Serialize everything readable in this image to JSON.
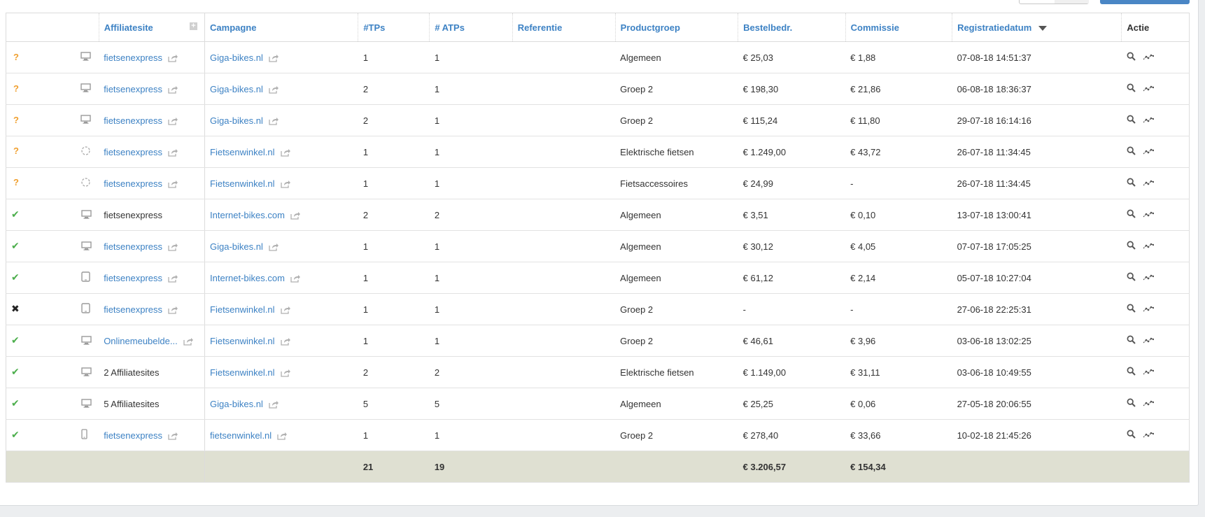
{
  "columns": {
    "affiliatesite": "Affiliatesite",
    "campagne": "Campagne",
    "tps": "#TPs",
    "atps": "# ATPs",
    "referentie": "Referentie",
    "productgroep": "Productgroep",
    "bestelbedr": "Bestelbedr.",
    "commissie": "Commissie",
    "registratiedatum": "Registratiedatum",
    "actie": "Actie"
  },
  "rows": [
    {
      "status": "pending",
      "device": "desktop",
      "site": "fietsenexpress",
      "site_link": true,
      "campaign": "Giga-bikes.nl",
      "tps": "1",
      "atps": "1",
      "ref": "",
      "group": "Algemeen",
      "amount": "€ 25,03",
      "commission": "€ 1,88",
      "date": "07-08-18 14:51:37"
    },
    {
      "status": "pending",
      "device": "desktop",
      "site": "fietsenexpress",
      "site_link": true,
      "campaign": "Giga-bikes.nl",
      "tps": "2",
      "atps": "1",
      "ref": "",
      "group": "Groep 2",
      "amount": "€ 198,30",
      "commission": "€ 21,86",
      "date": "06-08-18 18:36:37"
    },
    {
      "status": "pending",
      "device": "desktop",
      "site": "fietsenexpress",
      "site_link": true,
      "campaign": "Giga-bikes.nl",
      "tps": "2",
      "atps": "1",
      "ref": "",
      "group": "Groep 2",
      "amount": "€ 115,24",
      "commission": "€ 11,80",
      "date": "29-07-18 16:14:16"
    },
    {
      "status": "pending",
      "device": "unknown",
      "site": "fietsenexpress",
      "site_link": true,
      "campaign": "Fietsenwinkel.nl",
      "tps": "1",
      "atps": "1",
      "ref": "",
      "group": "Elektrische fietsen",
      "amount": "€ 1.249,00",
      "commission": "€ 43,72",
      "date": "26-07-18 11:34:45"
    },
    {
      "status": "pending",
      "device": "unknown",
      "site": "fietsenexpress",
      "site_link": true,
      "campaign": "Fietsenwinkel.nl",
      "tps": "1",
      "atps": "1",
      "ref": "",
      "group": "Fietsaccessoires",
      "amount": "€ 24,99",
      "commission": "-",
      "date": "26-07-18 11:34:45"
    },
    {
      "status": "approved",
      "device": "desktop",
      "site": "fietsenexpress",
      "site_link": false,
      "campaign": "Internet-bikes.com",
      "tps": "2",
      "atps": "2",
      "ref": "",
      "group": "Algemeen",
      "amount": "€ 3,51",
      "commission": "€ 0,10",
      "date": "13-07-18 13:00:41"
    },
    {
      "status": "approved",
      "device": "desktop",
      "site": "fietsenexpress",
      "site_link": true,
      "campaign": "Giga-bikes.nl",
      "tps": "1",
      "atps": "1",
      "ref": "",
      "group": "Algemeen",
      "amount": "€ 30,12",
      "commission": "€ 4,05",
      "date": "07-07-18 17:05:25"
    },
    {
      "status": "approved",
      "device": "tablet",
      "site": "fietsenexpress",
      "site_link": true,
      "campaign": "Internet-bikes.com",
      "tps": "1",
      "atps": "1",
      "ref": "",
      "group": "Algemeen",
      "amount": "€ 61,12",
      "commission": "€ 2,14",
      "date": "05-07-18 10:27:04"
    },
    {
      "status": "rejected",
      "device": "tablet",
      "site": "fietsenexpress",
      "site_link": true,
      "campaign": "Fietsenwinkel.nl",
      "tps": "1",
      "atps": "1",
      "ref": "",
      "group": "Groep 2",
      "amount": "-",
      "commission": "-",
      "date": "27-06-18 22:25:31"
    },
    {
      "status": "approved",
      "device": "desktop",
      "site": "Onlinemeubelde...",
      "site_link": true,
      "campaign": "Fietsenwinkel.nl",
      "tps": "1",
      "atps": "1",
      "ref": "",
      "group": "Groep 2",
      "amount": "€ 46,61",
      "commission": "€ 3,96",
      "date": "03-06-18 13:02:25"
    },
    {
      "status": "approved",
      "device": "desktop",
      "site": "2 Affiliatesites",
      "site_link": false,
      "campaign": "Fietsenwinkel.nl",
      "tps": "2",
      "atps": "2",
      "ref": "",
      "group": "Elektrische fietsen",
      "amount": "€ 1.149,00",
      "commission": "€ 31,11",
      "date": "03-06-18 10:49:55"
    },
    {
      "status": "approved",
      "device": "desktop",
      "site": "5 Affiliatesites",
      "site_link": false,
      "campaign": "Giga-bikes.nl",
      "tps": "5",
      "atps": "5",
      "ref": "",
      "group": "Algemeen",
      "amount": "€ 25,25",
      "commission": "€ 0,06",
      "date": "27-05-18 20:06:55"
    },
    {
      "status": "approved",
      "device": "mobile",
      "site": "fietsenexpress",
      "site_link": true,
      "campaign": "fietsenwinkel.nl",
      "tps": "1",
      "atps": "1",
      "ref": "",
      "group": "Groep 2",
      "amount": "€ 278,40",
      "commission": "€ 33,66",
      "date": "10-02-18 21:45:26"
    }
  ],
  "totals": {
    "tps": "21",
    "atps": "19",
    "amount": "€ 3.206,57",
    "commission": "€ 154,34"
  },
  "icons": {
    "pending": "?",
    "approved": "✔",
    "rejected": "✖"
  },
  "colors": {
    "link": "#3d82c4",
    "pending": "#f0a030",
    "approved": "#4cae4c",
    "totals_bg": "#dfe0d2"
  }
}
